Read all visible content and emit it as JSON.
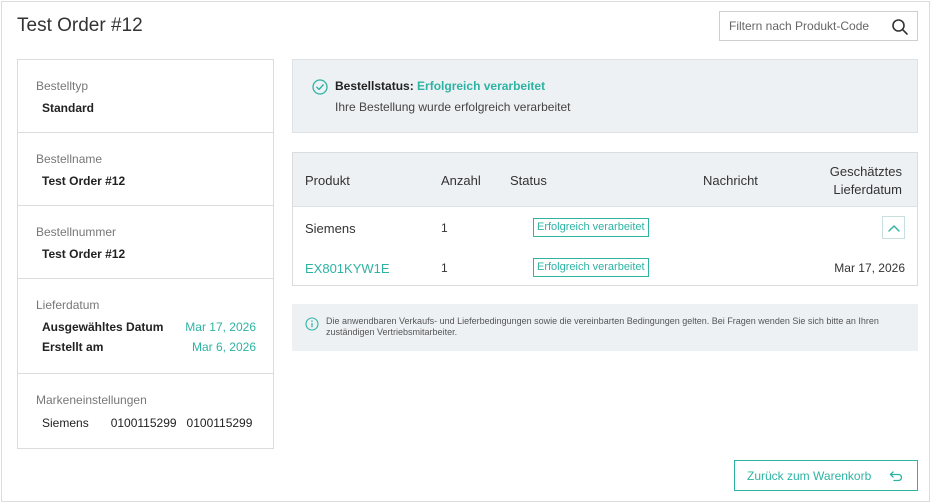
{
  "header": {
    "title": "Test Order #12",
    "search_placeholder": "Filtern nach Produkt-Code"
  },
  "sidebar": {
    "order_type": {
      "label": "Bestelltyp",
      "value": "Standard"
    },
    "order_name": {
      "label": "Bestellname",
      "value": "Test Order #12"
    },
    "order_number": {
      "label": "Bestellnummer",
      "value": "Test Order #12"
    },
    "delivery": {
      "label": "Lieferdatum",
      "selected_label": "Ausgewähltes Datum",
      "selected_value": "Mar 17, 2026",
      "created_label": "Erstellt am",
      "created_value": "Mar 6, 2026"
    },
    "brand": {
      "label": "Markeneinstellungen",
      "name": "Siemens",
      "code1": "0100115299",
      "code2": "0100115299"
    }
  },
  "status": {
    "label": "Bestellstatus:",
    "value": "Erfolgreich verarbeitet",
    "message": "Ihre Bestellung wurde erfolgreich verarbeitet"
  },
  "table": {
    "headers": {
      "product": "Produkt",
      "quantity": "Anzahl",
      "status": "Status",
      "message": "Nachricht",
      "date_line1": "Geschätztes",
      "date_line2": "Lieferdatum"
    },
    "rows": [
      {
        "product": "Siemens",
        "quantity": "1",
        "status": "Erfolgreich verarbeitet",
        "message": "",
        "date": ""
      },
      {
        "product": "EX801KYW1E",
        "quantity": "1",
        "status": "Erfolgreich verarbeitet",
        "message": "",
        "date": "Mar 17, 2026"
      }
    ]
  },
  "info": {
    "text": "Die anwendbaren Verkaufs- und Lieferbedingungen sowie die vereinbarten Bedingungen gelten. Bei Fragen wenden Sie sich bitte an Ihren zuständigen Vertriebsmitarbeiter."
  },
  "footer": {
    "back_label": "Zurück zum Warenkorb"
  },
  "colors": {
    "accent": "#2eb3a3",
    "panel_bg": "#eef1f4",
    "border": "#dcdcdc"
  }
}
